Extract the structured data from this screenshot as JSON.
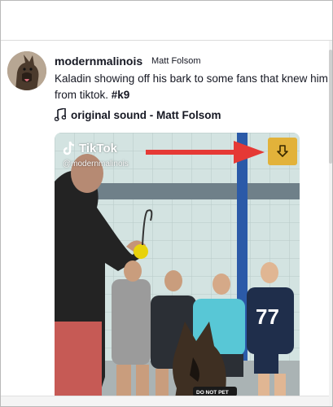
{
  "post": {
    "username": "modernmalinois",
    "nickname": "Matt Folsom",
    "caption_text": "Kaladin showing off his bark to some fans that knew him from tiktok. ",
    "caption_hashtag": "#k9",
    "sound_label": "original sound - Matt Folsom"
  },
  "video": {
    "watermark_brand": "TikTok",
    "watermark_handle": "@modernmalinois",
    "jersey_number": "77",
    "dog_vest_text": "DO NOT PET",
    "download_color": "#e2b23a",
    "arrow_color": "#e53935"
  },
  "icons": {
    "sound": "music-note-icon",
    "download": "download-arrow-icon",
    "brand": "tiktok-logo-icon"
  }
}
